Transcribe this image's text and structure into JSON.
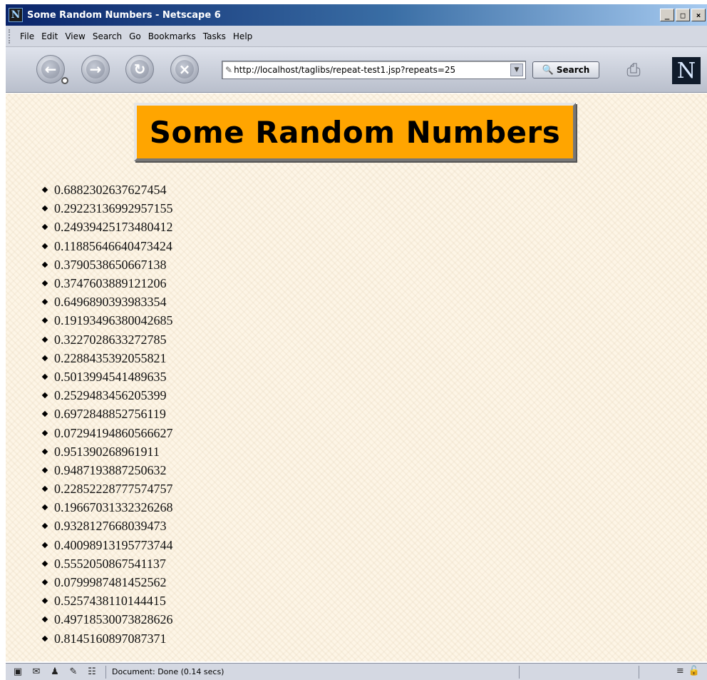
{
  "window": {
    "title": "Some Random Numbers - Netscape 6",
    "minimize": "_",
    "maximize": "□",
    "close": "×"
  },
  "menu": {
    "items": [
      "File",
      "Edit",
      "View",
      "Search",
      "Go",
      "Bookmarks",
      "Tasks",
      "Help"
    ]
  },
  "toolbar": {
    "back_icon": "back-icon",
    "forward_icon": "forward-icon",
    "reload_icon": "reload-icon",
    "stop_icon": "stop-icon",
    "url": "http://localhost/taglibs/repeat-test1.jsp?repeats=25",
    "search_label": "Search",
    "print_icon": "print-icon",
    "logo": "N"
  },
  "page": {
    "heading": "Some Random Numbers",
    "numbers": [
      "0.6882302637627454",
      "0.29223136992957155",
      "0.24939425173480412",
      "0.11885646640473424",
      "0.3790538650667138",
      "0.3747603889121206",
      "0.6496890393983354",
      "0.19193496380042685",
      "0.3227028633272785",
      "0.2288435392055821",
      "0.5013994541489635",
      "0.2529483456205399",
      "0.6972848852756119",
      "0.07294194860566627",
      "0.951390268961911",
      "0.9487193887250632",
      "0.22852228777574757",
      "0.19667031332326268",
      "0.9328127668039473",
      "0.40098913195773744",
      "0.5552050867541137",
      "0.0799987481452562",
      "0.5257438110144415",
      "0.49718530073828626",
      "0.8145160897087371"
    ]
  },
  "status": {
    "text": "Document: Done (0.14 secs)"
  },
  "colors": {
    "banner_bg": "#ffa500",
    "page_bg": "#fdf5e6"
  }
}
